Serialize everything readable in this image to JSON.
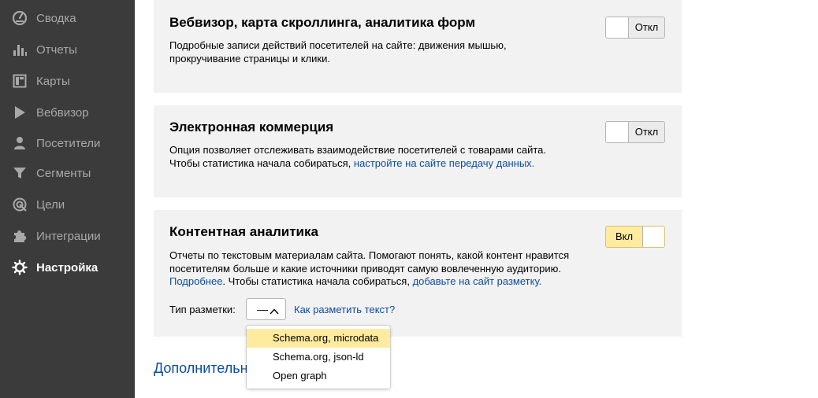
{
  "sidebar": {
    "items": [
      {
        "label": "Сводка",
        "icon": "dashboard-icon"
      },
      {
        "label": "Отчеты",
        "icon": "bar-chart-icon"
      },
      {
        "label": "Карты",
        "icon": "map-icon"
      },
      {
        "label": "Вебвизор",
        "icon": "play-icon"
      },
      {
        "label": "Посетители",
        "icon": "user-icon"
      },
      {
        "label": "Сегменты",
        "icon": "filter-icon"
      },
      {
        "label": "Цели",
        "icon": "target-icon"
      },
      {
        "label": "Интеграции",
        "icon": "puzzle-icon"
      },
      {
        "label": "Настройка",
        "icon": "gear-icon",
        "active": true
      }
    ]
  },
  "cards": {
    "webvisor": {
      "title": "Вебвизор, карта скроллинга, аналитика форм",
      "desc_line1": "Подробные записи действий посетителей на сайте: движения мышью,",
      "desc_line2": "прокручивание страницы и клики.",
      "toggle_label": "Откл",
      "enabled": false
    },
    "ecommerce": {
      "title": "Электронная коммерция",
      "desc_line1": "Опция позволяет отслеживать взаимодействие посетителей с товарами сайта.",
      "desc_line2_prefix": "Чтобы статистика начала собираться, ",
      "desc_line2_link": "настройте на сайте передачу данных.",
      "toggle_label": "Откл",
      "enabled": false
    },
    "content": {
      "title": "Контентная аналитика",
      "desc_line1": "Отчеты по текстовым материалам сайта. Помогают понять, какой контент нравится",
      "desc_line2": "посетителям больше и какие источники приводят самую вовлеченную аудиторию.",
      "desc_line3_link1": "Подробнее",
      "desc_line3_mid": ". Чтобы статистика начала собираться, ",
      "desc_line3_link2": "добавьте на сайт разметку.",
      "toggle_label": "Вкл",
      "enabled": true,
      "markup_label": "Тип разметки:",
      "markup_value": "—",
      "help_link": "Как разметить текст?"
    }
  },
  "dropdown": {
    "options": [
      "Schema.org, microdata",
      "Schema.org, json-ld",
      "Open graph"
    ],
    "highlighted": "Schema.org, microdata"
  },
  "footer": {
    "more_link": "Дополнительн"
  },
  "colors": {
    "sidebar_bg": "#3b3b3b",
    "card_bg": "#f2f2f2",
    "link": "#0c4ca1",
    "toggle_on": "#ffeba0"
  }
}
